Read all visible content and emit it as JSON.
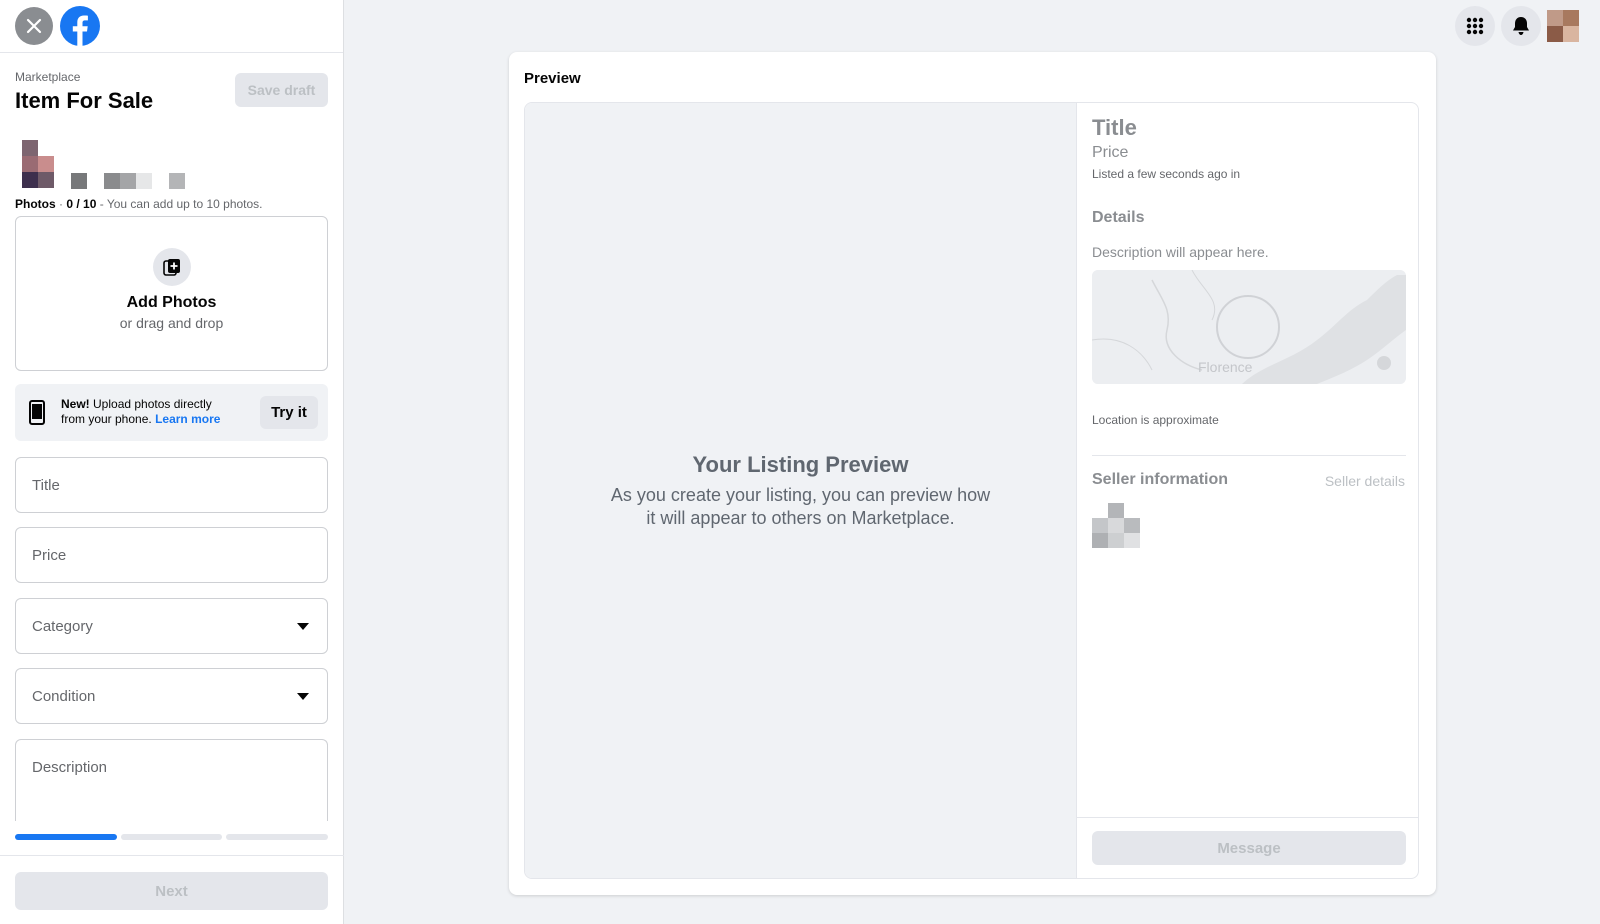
{
  "header": {
    "breadcrumb": "Marketplace",
    "title": "Item For Sale",
    "save_draft": "Save draft"
  },
  "photos": {
    "label": "Photos",
    "count": "0 / 10",
    "hint": "You can add up to 10 photos.",
    "add_label": "Add Photos",
    "add_sub": "or drag and drop"
  },
  "promo": {
    "new": "New!",
    "text_line1": "Upload photos directly",
    "text_line2": "from your phone.",
    "learn_more": "Learn more",
    "try_it": "Try it"
  },
  "form": {
    "title_placeholder": "Title",
    "price_placeholder": "Price",
    "category_placeholder": "Category",
    "condition_placeholder": "Condition",
    "description_placeholder": "Description"
  },
  "progress": {
    "current_step": 1,
    "total_steps": 3
  },
  "footer": {
    "next": "Next"
  },
  "preview": {
    "heading": "Preview",
    "empty_title": "Your Listing Preview",
    "empty_text": "As you create your listing, you can preview how it will appear to others on Marketplace.",
    "title": "Title",
    "price": "Price",
    "listed": "Listed a few seconds ago in",
    "details": "Details",
    "description": "Description will appear here.",
    "map_city": "Florence",
    "location_note": "Location is approximate",
    "seller_info": "Seller information",
    "seller_details": "Seller details",
    "message": "Message"
  },
  "colors": {
    "accent": "#1877f2",
    "background": "#f0f2f5"
  }
}
